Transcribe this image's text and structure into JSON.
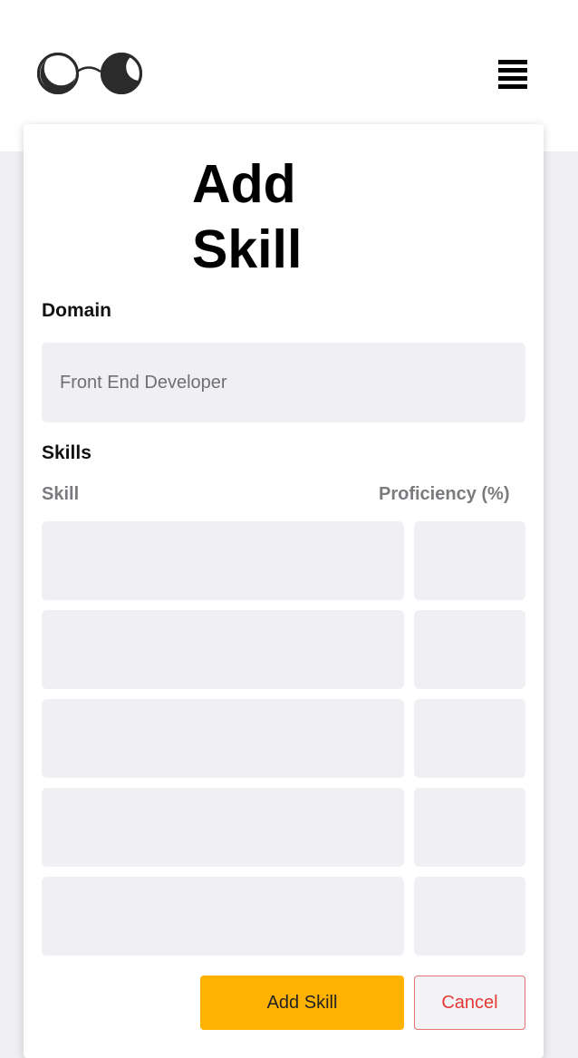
{
  "header": {
    "logo_icon": "glasses-logo-icon",
    "menu_icon": "hamburger-menu-icon"
  },
  "form": {
    "title_line1": "Add",
    "title_line2": "Skill",
    "domain_label": "Domain",
    "domain_placeholder": "Front End Developer",
    "skills_label": "Skills",
    "skill_column": "Skill",
    "proficiency_column": "Proficiency (%)",
    "add_label": "Add Skill",
    "cancel_label": "Cancel"
  },
  "colors": {
    "accent": "#ffb300",
    "cancel": "#e53935",
    "field_bg": "#efeff4"
  }
}
